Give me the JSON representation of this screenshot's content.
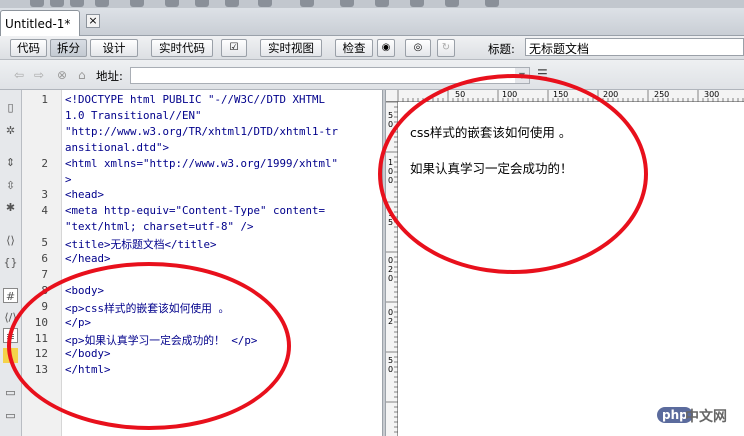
{
  "document_tab": {
    "label": "Untitled-1*",
    "close": "×"
  },
  "toolbar": {
    "code_label": "代码",
    "split_label": "拆分",
    "design_label": "设计",
    "live_code_label": "实时代码",
    "live_view_label": "实时视图",
    "inspect_label": "检查",
    "title_label": "标题:",
    "title_value": "无标题文档"
  },
  "address_bar": {
    "label": "地址:",
    "value": ""
  },
  "code_view": {
    "lines": [
      {
        "num": "1",
        "text": "<!DOCTYPE html PUBLIC \"-//W3C//DTD XHTML"
      },
      {
        "num": "",
        "text": "1.0 Transitional//EN\""
      },
      {
        "num": "",
        "text": "\"http://www.w3.org/TR/xhtml1/DTD/xhtml1-tr"
      },
      {
        "num": "",
        "text": "ansitional.dtd\">"
      },
      {
        "num": "2",
        "text": "<html xmlns=\"http://www.w3.org/1999/xhtml\""
      },
      {
        "num": "",
        "text": ">"
      },
      {
        "num": "3",
        "text": "<head>"
      },
      {
        "num": "4",
        "text": "<meta http-equiv=\"Content-Type\" content="
      },
      {
        "num": "",
        "text": "\"text/html; charset=utf-8\" />"
      },
      {
        "num": "5",
        "text": "<title>无标题文档</title>"
      },
      {
        "num": "6",
        "text": "</head>"
      },
      {
        "num": "7",
        "text": ""
      },
      {
        "num": "8",
        "text": "<body>"
      },
      {
        "num": "9",
        "text": "<p>css样式的嵌套该如何使用 。"
      },
      {
        "num": "10",
        "text": "</p>"
      },
      {
        "num": "11",
        "text": "<p>如果认真学习一定会成功的！ </p>"
      },
      {
        "num": "12",
        "text": "</body>"
      },
      {
        "num": "13",
        "text": "</html>"
      }
    ]
  },
  "design_view": {
    "ruler_top": [
      "50",
      "100",
      "150",
      "200",
      "250",
      "300"
    ],
    "ruler_left": [
      "5",
      "0",
      "1",
      "0",
      "0",
      "1",
      "5",
      "0",
      "2",
      "0",
      "0",
      "2",
      "5",
      "0"
    ],
    "paragraphs": [
      "css样式的嵌套该如何使用 。",
      "如果认真学习一定会成功的！"
    ]
  },
  "watermark": {
    "badge": "php",
    "text": "中文网"
  },
  "colors": {
    "annotation": "#e8101c",
    "code_tag": "#00008b"
  }
}
